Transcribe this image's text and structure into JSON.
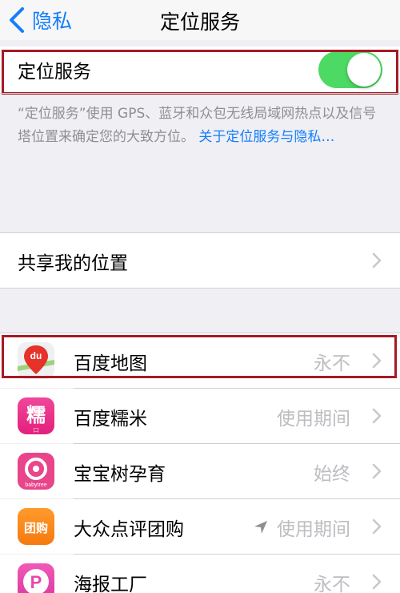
{
  "navbar": {
    "back_label": "隐私",
    "title": "定位服务"
  },
  "location_services": {
    "label": "定位服务",
    "toggle_on": true,
    "toggle_color": "#4cd964",
    "description": "“定位服务”使用 GPS、蓝牙和众包无线局域网热点以及信号塔位置来确定您的大致方位。",
    "link": "关于定位服务与隐私…"
  },
  "share_location": {
    "label": "共享我的位置"
  },
  "apps": [
    {
      "name": "百度地图",
      "status": "永不",
      "icon": "baidu-map-icon",
      "location_arrow": false
    },
    {
      "name": "百度糯米",
      "status": "使用期间",
      "icon": "baidu-nuomi-icon",
      "location_arrow": false
    },
    {
      "name": "宝宝树孕育",
      "status": "始终",
      "icon": "babytree-icon",
      "location_arrow": false
    },
    {
      "name": "大众点评团购",
      "status": "使用期间",
      "icon": "dianping-tuangou-icon",
      "location_arrow": true
    },
    {
      "name": "海报工厂",
      "status": "永不",
      "icon": "poster-factory-icon",
      "location_arrow": false
    }
  ],
  "icon_text": {
    "baidu_map": "du",
    "nuomi": "糯",
    "nuomi_sub": "口",
    "babytree": "babytree",
    "dianping": "团购",
    "poster": "P"
  },
  "colors": {
    "accent": "#157efb",
    "highlight_border": "#a51b24",
    "status_text": "#bdbdc2"
  }
}
